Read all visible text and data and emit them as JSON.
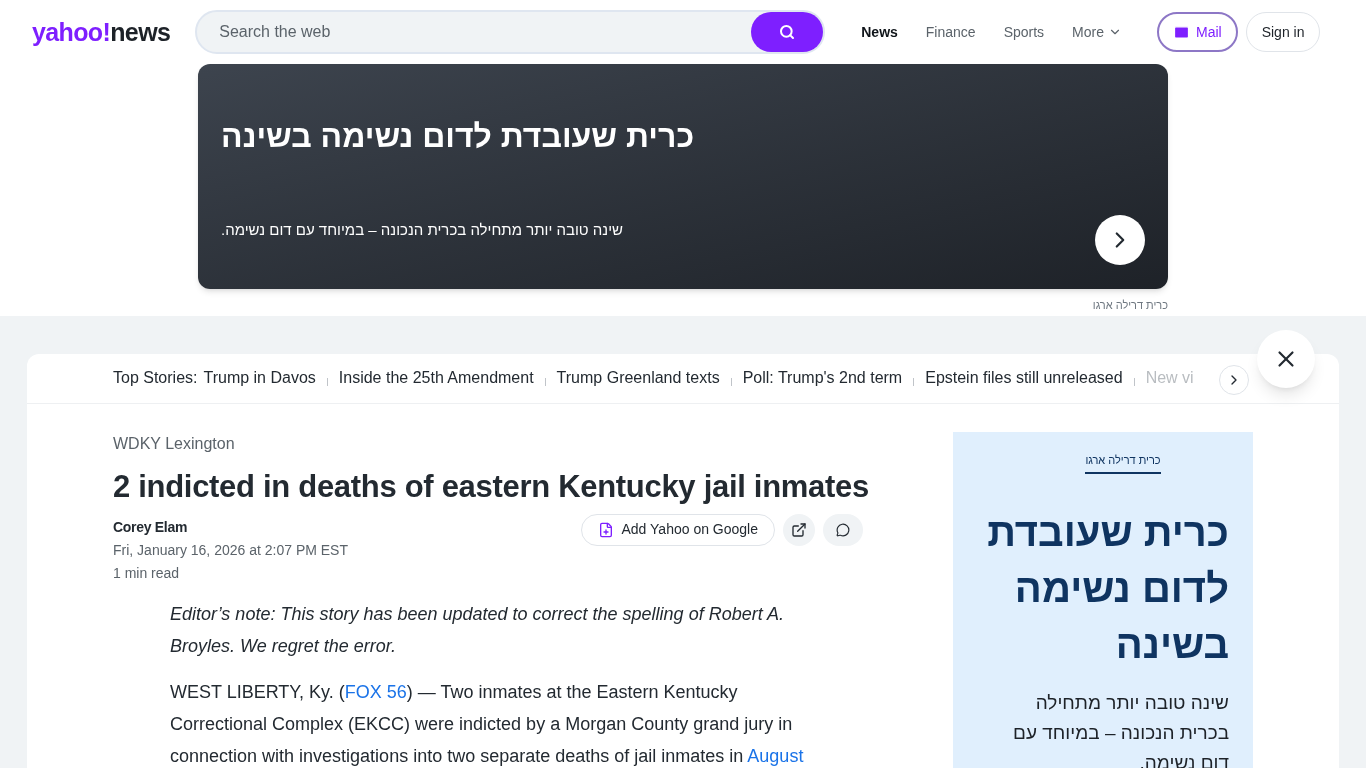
{
  "header": {
    "logo": {
      "main": "yahoo!",
      "sub": "news"
    },
    "search": {
      "placeholder": "Search the web"
    },
    "nav": [
      {
        "label": "News",
        "selected": true
      },
      {
        "label": "Finance",
        "selected": false
      },
      {
        "label": "Sports",
        "selected": false
      },
      {
        "label": "More",
        "selected": false,
        "dropdown": true
      }
    ],
    "mail": "Mail",
    "sign_in": "Sign in"
  },
  "banner_ad": {
    "title": "כרית שעובדת לדום נשימה בשינה",
    "text": "שינה טובה יותר מתחילה בכרית הנכונה – במיוחד עם דום נשימה.",
    "sponsor": "כרית דרילה ארגו"
  },
  "top_stories": {
    "label": "Top Stories:",
    "items": [
      "Trump in Davos",
      "Inside the 25th Amendment",
      "Trump Greenland texts",
      "Poll: Trump's 2nd term",
      "Epstein files still unreleased",
      "New vi"
    ]
  },
  "article": {
    "source": "WDKY Lexington",
    "title": "2 indicted in deaths of eastern Kentucky jail inmates",
    "author": "Corey Elam",
    "date": "Fri, January 16, 2026 at 2:07 PM EST",
    "read_time": "1 min read",
    "add_button": "Add Yahoo on Google",
    "editor_note": "Editor’s note: This story has been updated to correct the spelling of Robert A. Broyles. We regret the error.",
    "paragraph": [
      {
        "kind": "text",
        "text": "WEST LIBERTY, Ky. ("
      },
      {
        "kind": "link",
        "text": "FOX 56"
      },
      {
        "kind": "text",
        "text": ") — Two inmates at the Eastern Kentucky Correctional Complex (EKCC) were indicted by a Morgan County grand jury in connection with investigations into two separate deaths of jail inmates in "
      },
      {
        "kind": "link",
        "text": "August"
      }
    ]
  },
  "side_ad": {
    "sponsor": "כרית דרילה ארגו",
    "title": "כרית שעובדת לדום נשימה בשינה",
    "text": "שינה טובה יותר מתחילה בכרית הנכונה – במיוחד עם דום נשימה."
  }
}
